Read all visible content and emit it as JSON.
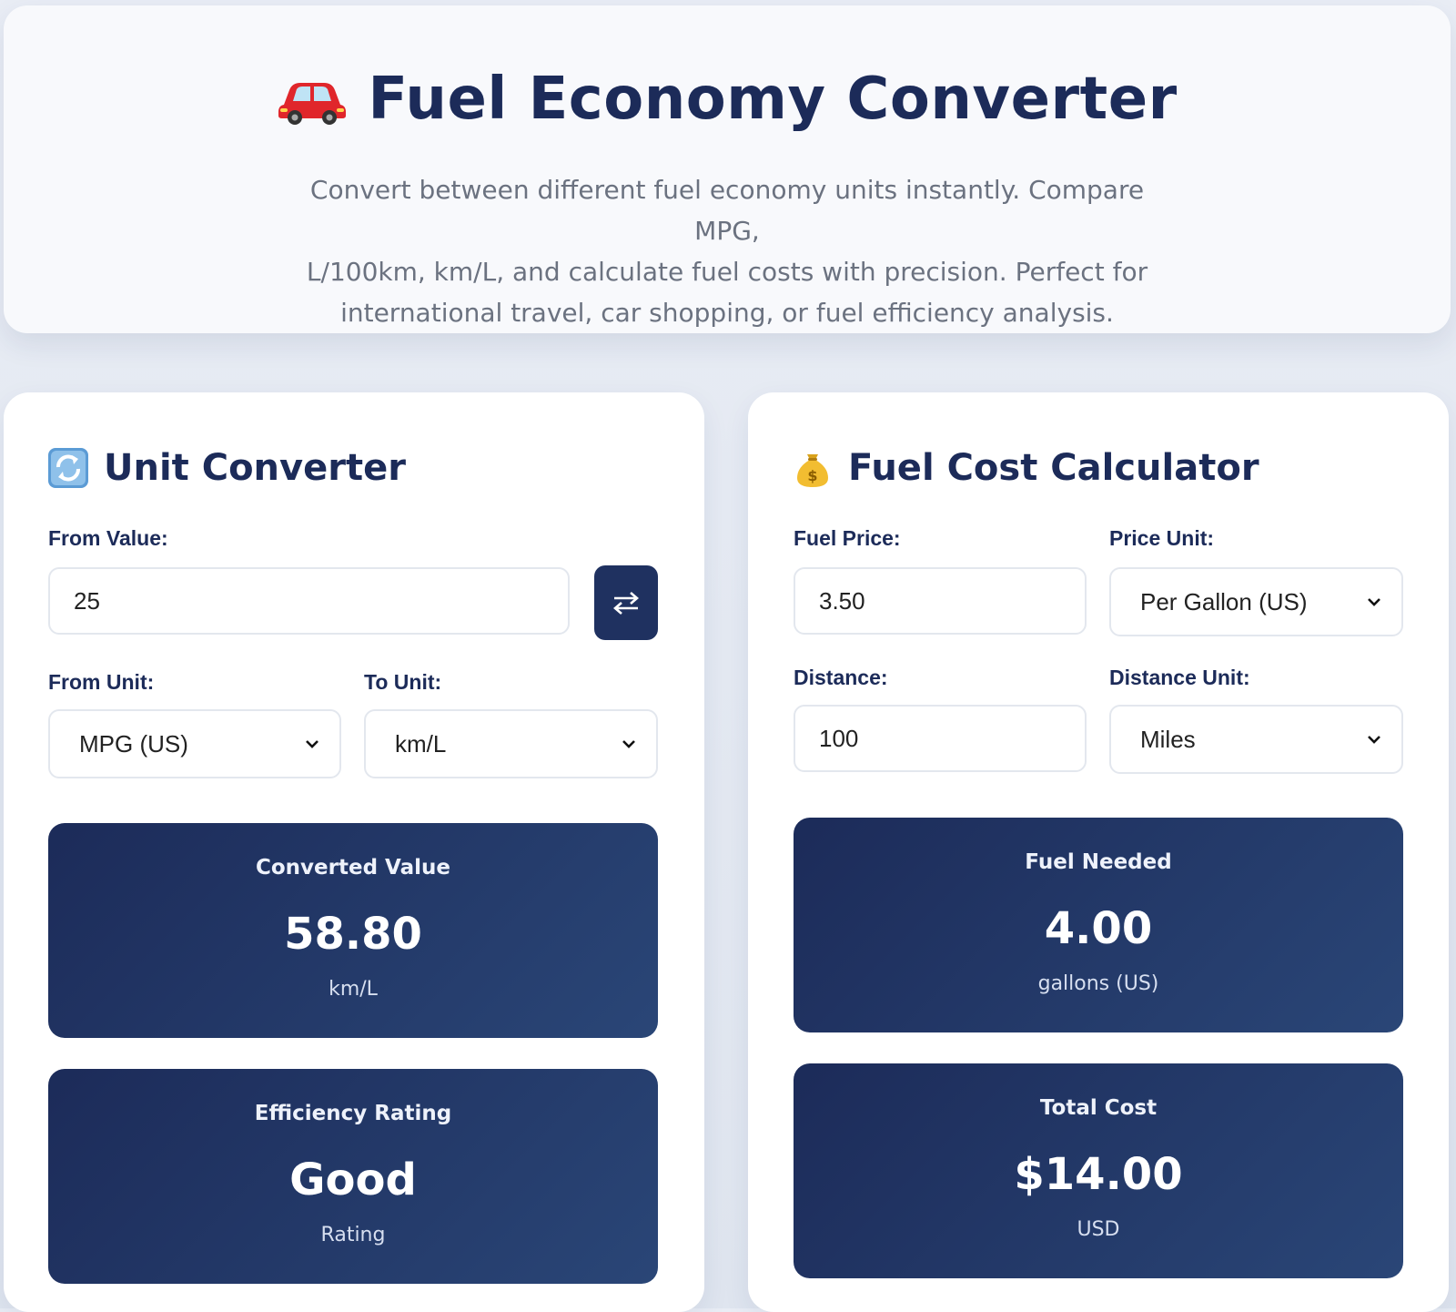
{
  "header": {
    "title": "Fuel Economy Converter",
    "title_icon": "car-icon",
    "subtitle_lines": [
      "Convert between different fuel economy units instantly. Compare MPG,",
      "L/100km, km/L, and calculate fuel costs with precision. Perfect for",
      "international travel, car shopping, or fuel efficiency analysis."
    ]
  },
  "unit_converter": {
    "title": "Unit Converter",
    "title_icon": "arrows-cycle-icon",
    "from_value_label": "From Value:",
    "from_value": "25",
    "swap_icon": "swap-arrows-icon",
    "from_unit_label": "From Unit:",
    "from_unit": "MPG (US)",
    "to_unit_label": "To Unit:",
    "to_unit": "km/L",
    "converted": {
      "label": "Converted Value",
      "value": "58.80",
      "unit": "km/L"
    },
    "rating": {
      "label": "Efficiency Rating",
      "value": "Good",
      "unit": "Rating"
    }
  },
  "cost_calculator": {
    "title": "Fuel Cost Calculator",
    "title_icon": "money-bag-icon",
    "fuel_price_label": "Fuel Price:",
    "fuel_price": "3.50",
    "price_unit_label": "Price Unit:",
    "price_unit": "Per Gallon (US)",
    "distance_label": "Distance:",
    "distance": "100",
    "distance_unit_label": "Distance Unit:",
    "distance_unit": "Miles",
    "fuel_needed": {
      "label": "Fuel Needed",
      "value": "4.00",
      "unit": "gallons (US)"
    },
    "total_cost": {
      "label": "Total Cost",
      "value": "$14.00",
      "unit": "USD"
    }
  },
  "colors": {
    "primary": "#1c2b59",
    "result_gradient_end": "#2a4677",
    "subtitle": "#6b7280",
    "input_border": "#e3e7ee"
  }
}
